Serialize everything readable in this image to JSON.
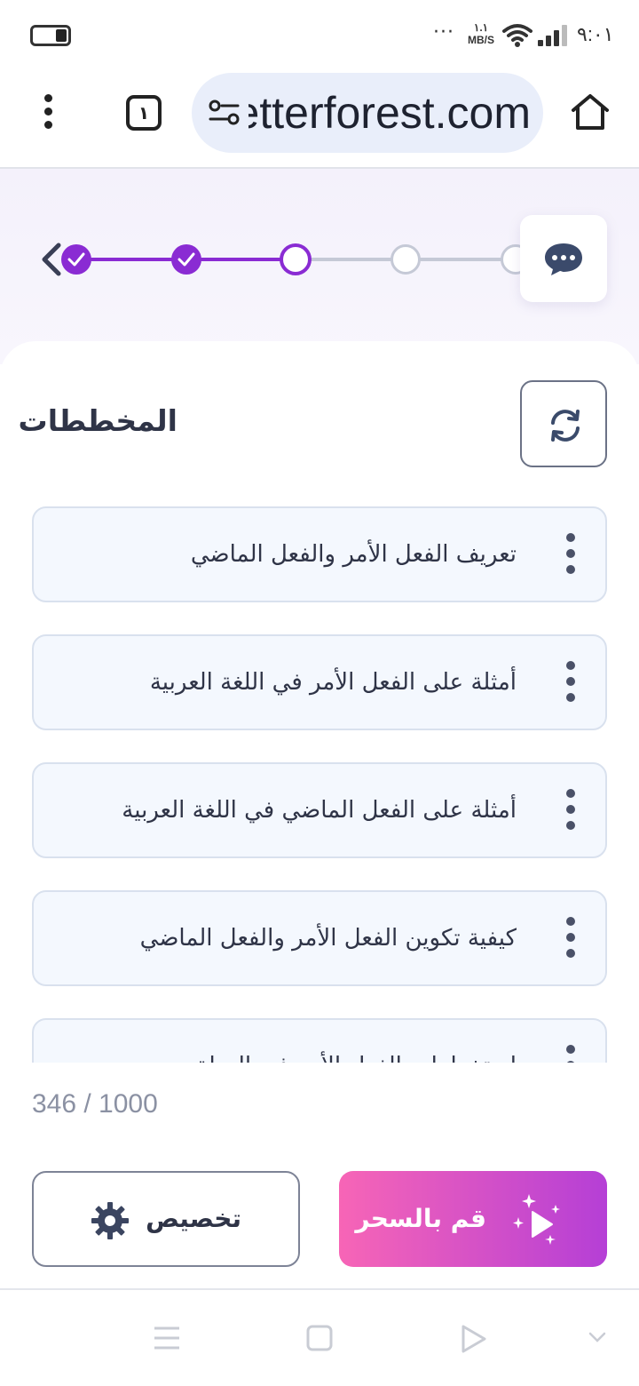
{
  "status_bar": {
    "time": "٩:٠١",
    "net_speed_value": "١.١",
    "net_speed_unit": "MB/S",
    "more": "···"
  },
  "browser": {
    "url": "letterforest.com",
    "tab_count": "١"
  },
  "stepper": {
    "steps": [
      "done",
      "done",
      "current",
      "todo",
      "todo"
    ],
    "accent": "#8a2bd3"
  },
  "main": {
    "section_title": "المخططات",
    "outline_items": [
      "تعريف الفعل الأمر والفعل الماضي",
      "أمثلة على الفعل الأمر في اللغة العربية",
      "أمثلة على الفعل الماضي في اللغة العربية",
      "كيفية تكوين الفعل الأمر والفعل الماضي",
      "استخدامات الفعل الأمر في الحياة"
    ],
    "char_counter": "346 / 1000"
  },
  "footer": {
    "customize_label": "تخصيص",
    "magic_label": "قم بالسحر"
  },
  "icons": {
    "chat": "chat-bubble-icon",
    "refresh": "refresh-icon",
    "settings": "gear-icon",
    "magic": "sparkle-play-icon"
  }
}
